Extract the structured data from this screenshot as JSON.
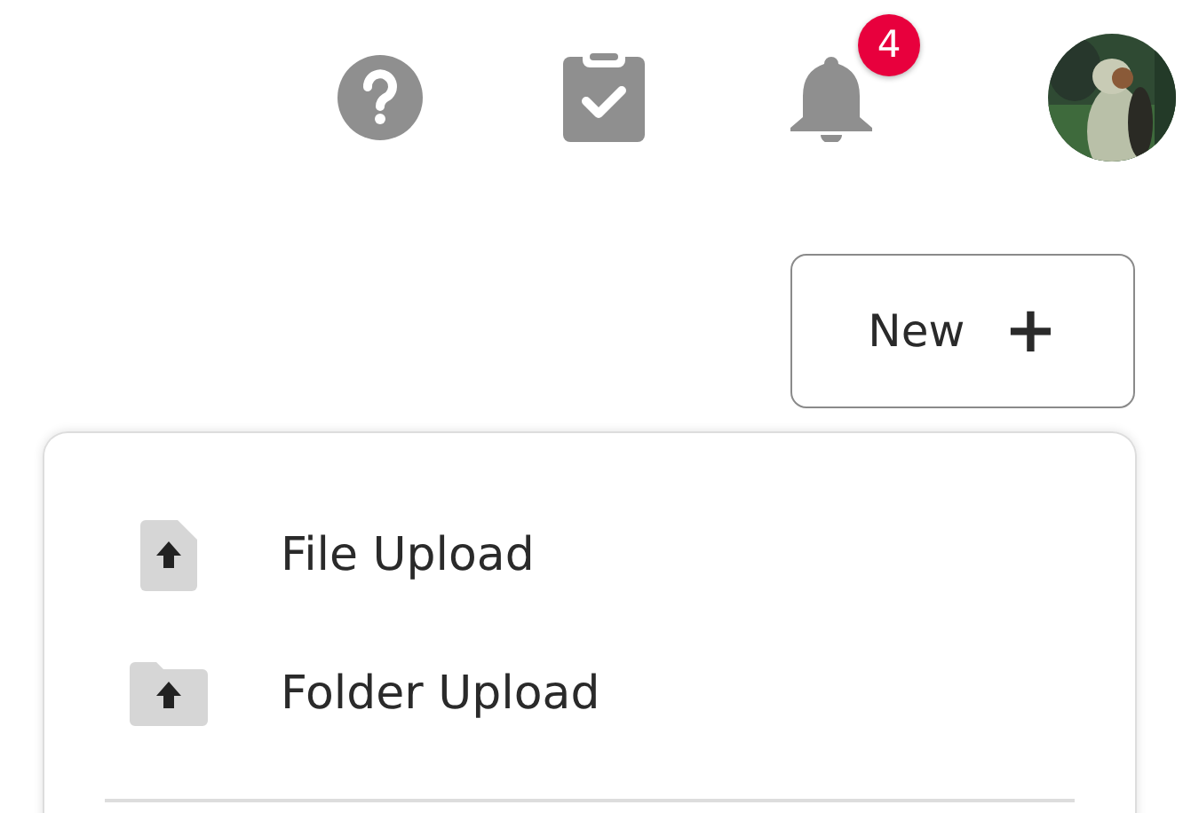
{
  "toolbar": {
    "notification_count": "4"
  },
  "new_button": {
    "label": "New",
    "icon": "+"
  },
  "menu": {
    "items": [
      {
        "kind": "file",
        "label": "File Upload"
      },
      {
        "kind": "folder",
        "label": "Folder Upload"
      }
    ]
  }
}
